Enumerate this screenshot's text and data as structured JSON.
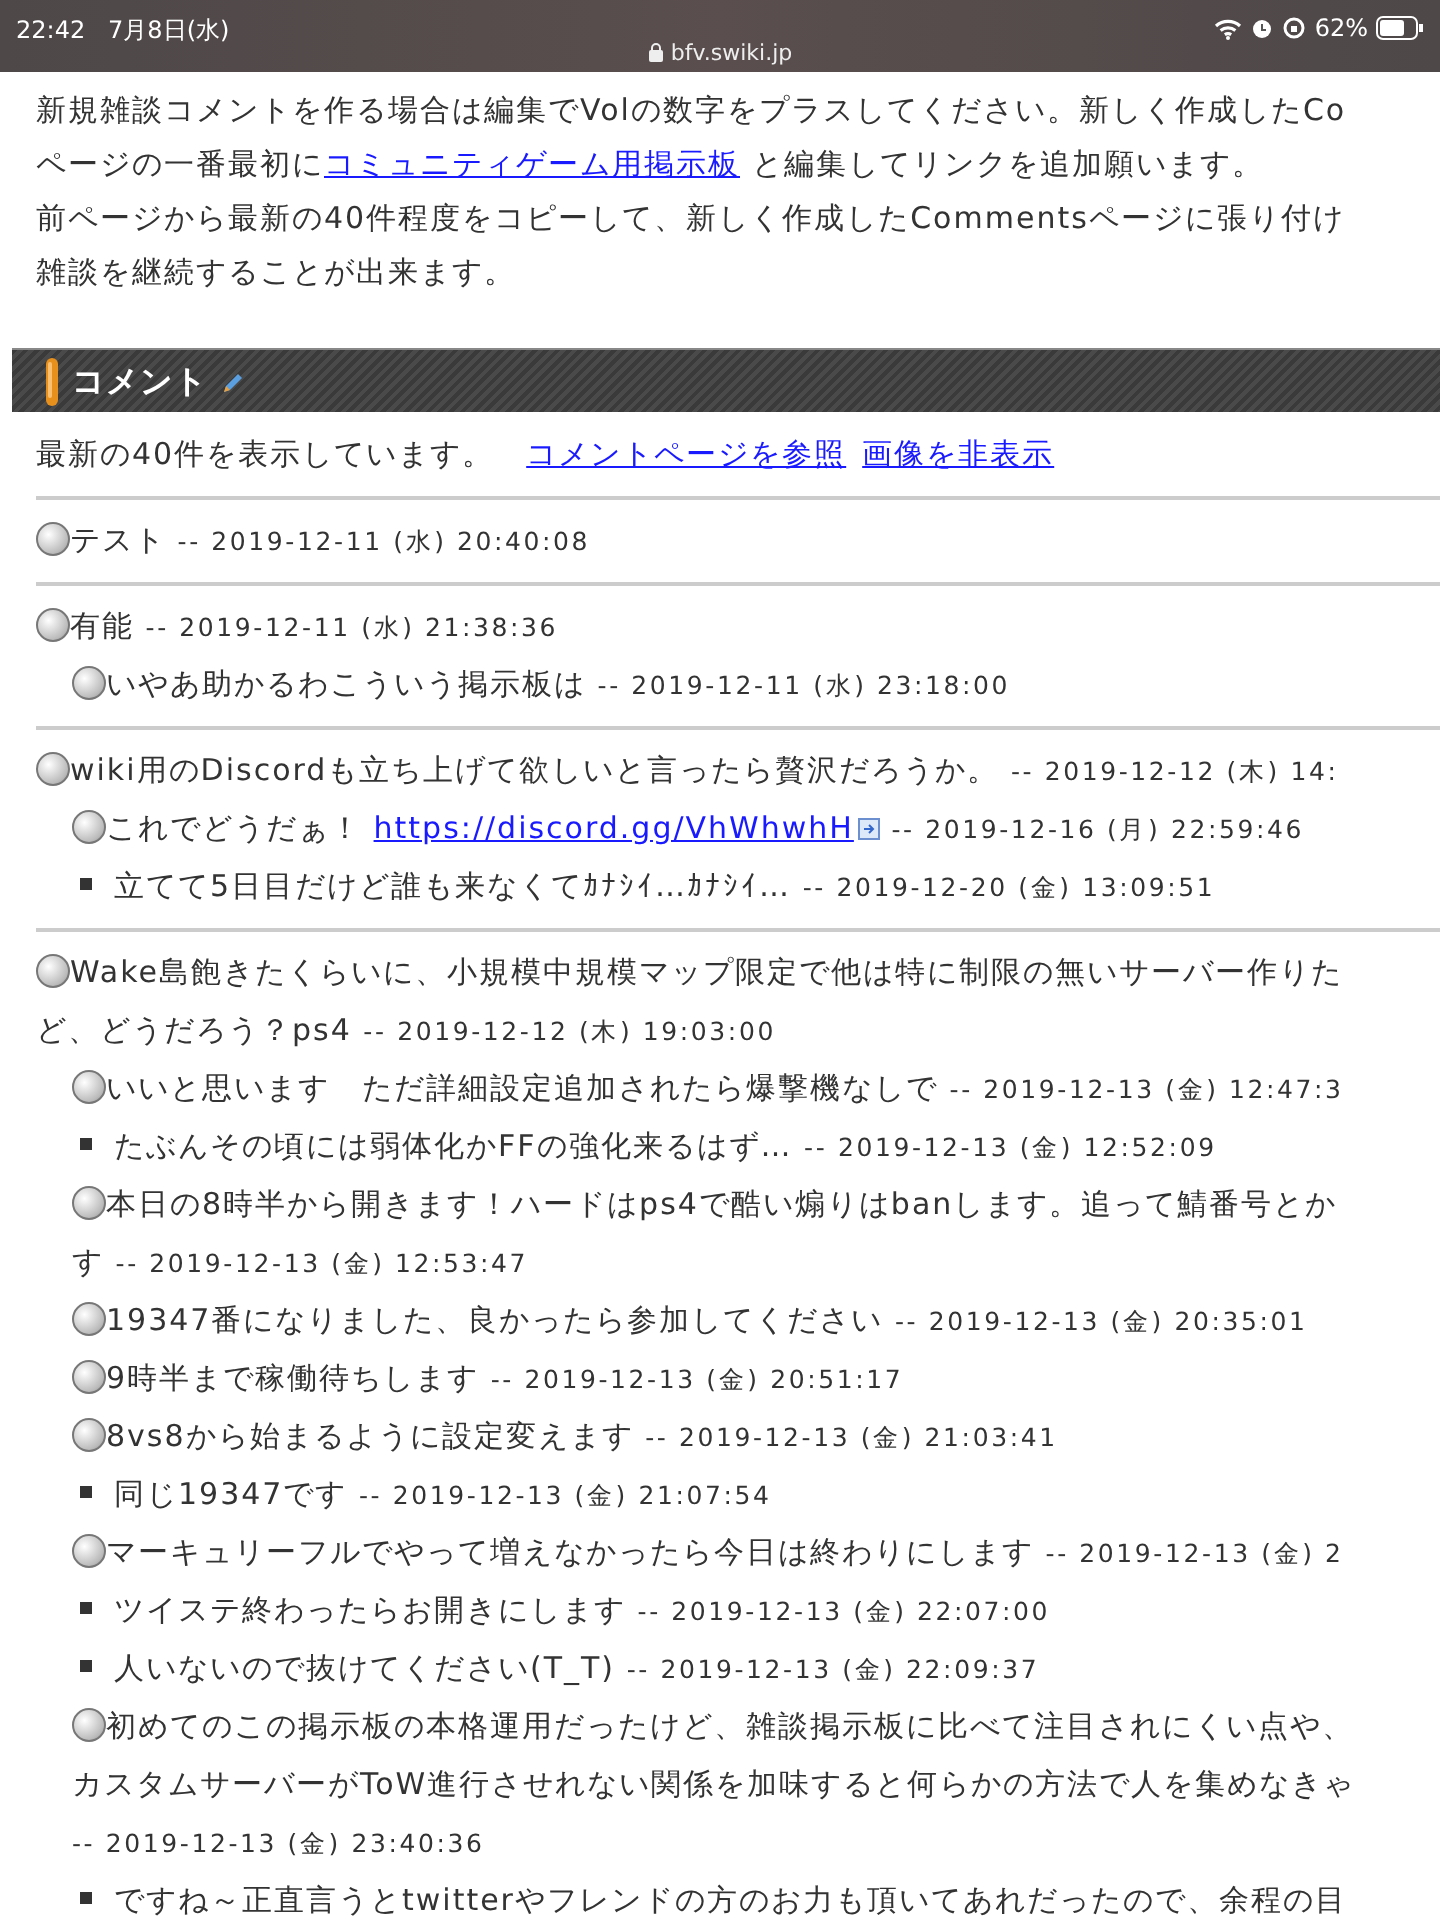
{
  "status_bar": {
    "time": "22:42",
    "date": "7月8日(水)",
    "url": "bfv.swiki.jp",
    "battery": "62%"
  },
  "intro": [
    {
      "parts": [
        {
          "text": "新規雑談コメントを作る場合は編集でVolの数字をプラスしてください。新しく作成したCo"
        }
      ]
    },
    {
      "parts": [
        {
          "text": "ページの一番最初に"
        },
        {
          "text": "コミュニティゲーム用掲示板",
          "link": true
        },
        {
          "text": " と編集してリンクを追加願います。"
        }
      ]
    },
    {
      "parts": [
        {
          "text": "前ページから最新の40件程度をコピーして、新しく作成したCommentsページに張り付け"
        }
      ]
    },
    {
      "parts": [
        {
          "text": "雑談を継続することが出来ます。"
        }
      ]
    }
  ],
  "section": {
    "title": "コメント"
  },
  "info": {
    "text": "最新の40件を表示しています。",
    "links": [
      "コメントページを参照",
      "画像を非表示"
    ]
  },
  "threads": [
    {
      "lines": [
        "テスト"
      ],
      "date": "-- 2019-12-11 (水) 20:40:08"
    },
    {
      "lines": [
        "有能"
      ],
      "date": "-- 2019-12-11 (水) 21:38:36",
      "replies": [
        {
          "kind": "circle",
          "lines": [
            "いやあ助かるわこういう掲示板は"
          ],
          "date": "-- 2019-12-11 (水) 23:18:00"
        }
      ]
    },
    {
      "lines": [
        "wiki用のDiscordも立ち上げて欲しいと言ったら贅沢だろうか。"
      ],
      "date": "-- 2019-12-12 (木) 14:",
      "replies": [
        {
          "kind": "circle",
          "lines": [
            "これでどうだぁ！"
          ],
          "link": "https://discord.gg/VhWhwhH",
          "date": "-- 2019-12-16 (月) 22:59:46"
        },
        {
          "kind": "square",
          "lines": [
            "立てて5日目だけど誰も来なくてｶﾅｼｲ…ｶﾅｼｲ…"
          ],
          "date": "-- 2019-12-20 (金) 13:09:51"
        }
      ]
    },
    {
      "lines": [
        "Wake島飽きたくらいに、小規模中規模マップ限定で他は特に制限の無いサーバー作りた",
        "ど、どうだろう？ps4"
      ],
      "date": "-- 2019-12-12 (木) 19:03:00",
      "replies": [
        {
          "kind": "circle",
          "lines": [
            "いいと思います　ただ詳細設定追加されたら爆撃機なしで"
          ],
          "date": "-- 2019-12-13 (金) 12:47:3"
        },
        {
          "kind": "square",
          "lines": [
            "たぶんその頃には弱体化かFFの強化来るはず…"
          ],
          "date": "-- 2019-12-13 (金) 12:52:09"
        },
        {
          "kind": "circle",
          "lines": [
            "本日の8時半から開きます！ハードはps4で酷い煽りはbanします。追って鯖番号とか",
            "す"
          ],
          "date": "-- 2019-12-13 (金) 12:53:47"
        },
        {
          "kind": "circle",
          "lines": [
            "19347番になりました、良かったら参加してください"
          ],
          "date": "-- 2019-12-13 (金) 20:35:01"
        },
        {
          "kind": "circle",
          "lines": [
            "9時半まで稼働待ちします"
          ],
          "date": "-- 2019-12-13 (金) 20:51:17"
        },
        {
          "kind": "circle",
          "lines": [
            "8vs8から始まるように設定変えます"
          ],
          "date": "-- 2019-12-13 (金) 21:03:41"
        },
        {
          "kind": "square",
          "lines": [
            "同じ19347です"
          ],
          "date": "-- 2019-12-13 (金) 21:07:54"
        },
        {
          "kind": "circle",
          "lines": [
            "マーキュリーフルでやって増えなかったら今日は終わりにします"
          ],
          "date": "-- 2019-12-13 (金) 2"
        },
        {
          "kind": "square",
          "lines": [
            "ツイステ終わったらお開きにします"
          ],
          "date": "-- 2019-12-13 (金) 22:07:00"
        },
        {
          "kind": "square",
          "lines": [
            "人いないので抜けてください(T_T)"
          ],
          "date": "-- 2019-12-13 (金) 22:09:37"
        },
        {
          "kind": "circle",
          "lines": [
            "初めてのこの掲示板の本格運用だったけど、雑談掲示板に比べて注目されにくい点や、",
            "カスタムサーバーがToW進行させれない関係を加味すると何らかの方法で人を集めなきゃ"
          ],
          "date": "-- 2019-12-13 (金) 23:40:36",
          "date_wraps": true
        },
        {
          "kind": "square",
          "lines": [
            "ですね～正直言うとtwitterやフレンドの方のお力も頂いてあれだったので、余程の目"
          ]
        }
      ]
    }
  ]
}
